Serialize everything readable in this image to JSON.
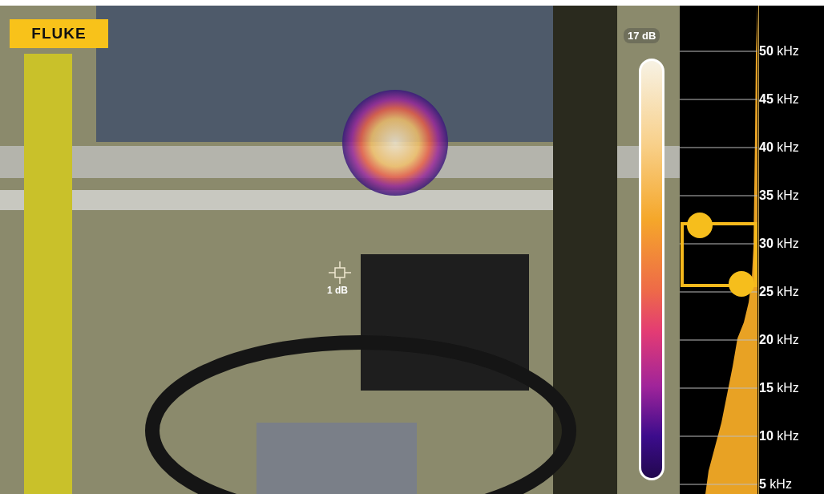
{
  "logo": {
    "text": "FLUKE"
  },
  "color_scale": {
    "max_label": "17 dB"
  },
  "marker": {
    "reading": "1 dB"
  },
  "frequency_axis": {
    "labels": [
      "**50** kHz",
      "**45** kHz",
      "**40** kHz",
      "**35** kHz",
      "**30** kHz",
      "**25** kHz",
      "**20** kHz",
      "**15** kHz",
      "**10** kHz",
      "**5** kHz"
    ]
  },
  "band_selector": {
    "handles": [
      {
        "level": 0.55
      },
      {
        "level": 0.43
      }
    ]
  }
}
